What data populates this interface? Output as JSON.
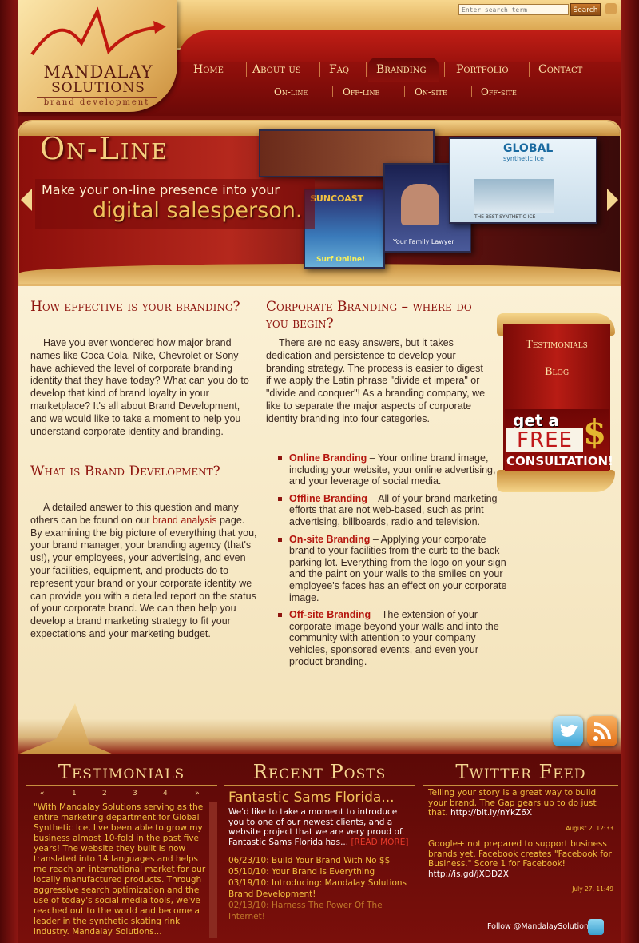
{
  "brand": {
    "name_line1": "MANDALAY",
    "name_line2": "SOLUTIONS",
    "tagline": "brand development"
  },
  "search": {
    "placeholder": "Enter search term",
    "button": "Search"
  },
  "nav": {
    "items": [
      "Home",
      "About us",
      "Faq",
      "Branding",
      "Portfolio",
      "Contact"
    ],
    "active": "Branding",
    "sub_items": [
      "On-line",
      "Off-line",
      "On-site",
      "Off-site"
    ]
  },
  "banner": {
    "title": "On-Line",
    "line1": "Make your on-line presence into your",
    "line2": "digital salesperson.",
    "shot_labels": {
      "global": "GLOBAL",
      "synthetic": "synthetic ice",
      "best": "THE BEST SYNTHETIC ICE",
      "suncoast": "SUNCOAST",
      "lawyer": "Your Family Lawyer",
      "surf": "Surf Online!"
    }
  },
  "content": {
    "left": {
      "heading1": "How effective is your branding?",
      "para1": "Have you ever wondered how major brand names like Coca Cola, Nike, Chevrolet or Sony have achieved the level of corporate branding identity that they have today? What can you do to develop that kind of brand loyalty in your marketplace? It's all about Brand Development, and we would like to take a moment to help you understand corporate identity and branding.",
      "heading2": "What is Brand Development?",
      "para2_start": "A detailed answer to this question and many others can be found on our ",
      "para2_link": "brand analysis",
      "para2_end": " page. By examining the big picture of everything that you, your brand manager, your branding agency (that's us!), your employees, your advertising, and even your facilities, equipment, and products do to represent your brand or your corporate identity we can provide you with a detailed report on the status of your corporate brand. We can then help you develop a brand marketing strategy to fit your expectations and your marketing budget."
    },
    "right": {
      "heading": "Corporate Branding – where do you begin?",
      "para": "There are no easy answers, but it takes dedication and persistence to develop your branding strategy. The process is easier to digest if we apply the Latin phrase \"divide et impera\" or \"divide and conquer\"! As a branding company, we like to separate the major aspects of corporate identity branding into four categories.",
      "list": [
        {
          "title": "Online Branding",
          "text": " – Your online brand image, including your website, your online advertising, and your leverage of social media."
        },
        {
          "title": "Offline Branding",
          "text": " – All of your brand marketing efforts that are not web-based, such as print advertising, billboards, radio and television."
        },
        {
          "title": "On-site Branding",
          "text": " – Applying your corporate brand to your facilities from the curb to the back parking lot. Everything from the logo on your sign and the paint on your walls to the smiles on your employee's faces has an effect on your corporate image."
        },
        {
          "title": "Off-site Branding",
          "text": " – The extension of your corporate image beyond your walls and into the community with attention to your company vehicles, sponsored events, and even your product branding."
        }
      ]
    }
  },
  "side_panel": {
    "testimonials": "Testimonials",
    "blog": "Blog",
    "promo_get": "get a",
    "promo_free": "FREE",
    "promo_dollar": "$",
    "promo_consult": "CONSULTATION!"
  },
  "footer": {
    "testimonials": {
      "title": "Testimonials",
      "pager": [
        "«",
        "1",
        "2",
        "3",
        "4",
        "»"
      ],
      "text": "\"With Mandalay Solutions serving as the entire marketing department for Global Synthetic Ice, I've been able to grow my business almost 10-fold in the past five years! The website they built is now translated into 14 languages and helps me reach an international market for our locally manufactured products. Through aggressive search optimization and the use of today's social media tools, we've reached out to the world and become a leader in the synthetic skating rink industry. Mandalay Solutions..."
    },
    "posts": {
      "title": "Recent Posts",
      "featured_title": "Fantastic Sams Florida...",
      "featured_body": "We'd like to take a moment to introduce you to one of our newest clients, and a website project that we are very proud of. Fantastic Sams Florida has... ",
      "read_more": "[READ MORE]",
      "links": [
        "06/23/10: Build Your Brand With No $$",
        "05/10/10: Your Brand Is Everything",
        "03/19/10: Introducing: Mandalay Solutions Brand Development!",
        "02/13/10: Harness The Power Of The Internet!"
      ]
    },
    "twitter": {
      "title": "Twitter Feed",
      "tweets": [
        {
          "text": "Telling your story is a great way to build your brand. The Gap gears up to do just that. ",
          "link": "http://bit.ly/nYkZ6X",
          "date": "August 2, 12:33"
        },
        {
          "text": "Google+ not prepared to support business brands yet. Facebook creates \"Facebook for Business.\" Score 1 for Facebook! ",
          "link": "http://is.gd/jXDD2X",
          "date": "July 27, 11:49"
        }
      ],
      "follow": "Follow @MandalaySolutions on"
    }
  },
  "colors": {
    "brand_red": "#8e140e",
    "gold": "#f6d792",
    "cream": "#fbf1d6"
  }
}
